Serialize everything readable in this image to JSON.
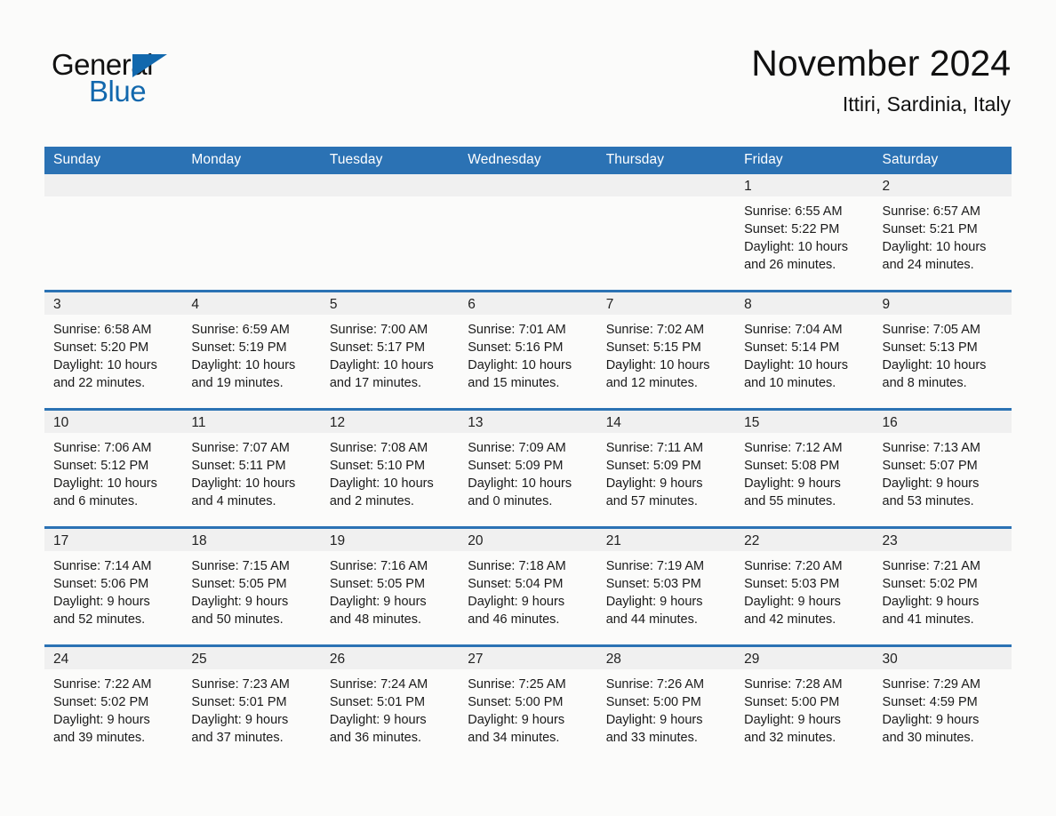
{
  "brand": {
    "name_part1": "General",
    "name_part2": "Blue",
    "accent_color": "#1268ad"
  },
  "header": {
    "title": "November 2024",
    "subtitle": "Ittiri, Sardinia, Italy"
  },
  "theme": {
    "header_blue": "#2b72b4",
    "daynum_band": "#f0f0f0",
    "page_background": "#fbfbfa"
  },
  "weekday_headers": [
    "Sunday",
    "Monday",
    "Tuesday",
    "Wednesday",
    "Thursday",
    "Friday",
    "Saturday"
  ],
  "weeks": [
    [
      {
        "day": "",
        "empty": true
      },
      {
        "day": "",
        "empty": true
      },
      {
        "day": "",
        "empty": true
      },
      {
        "day": "",
        "empty": true
      },
      {
        "day": "",
        "empty": true
      },
      {
        "day": "1",
        "sunrise": "Sunrise: 6:55 AM",
        "sunset": "Sunset: 5:22 PM",
        "daylight1": "Daylight: 10 hours",
        "daylight2": "and 26 minutes."
      },
      {
        "day": "2",
        "sunrise": "Sunrise: 6:57 AM",
        "sunset": "Sunset: 5:21 PM",
        "daylight1": "Daylight: 10 hours",
        "daylight2": "and 24 minutes."
      }
    ],
    [
      {
        "day": "3",
        "sunrise": "Sunrise: 6:58 AM",
        "sunset": "Sunset: 5:20 PM",
        "daylight1": "Daylight: 10 hours",
        "daylight2": "and 22 minutes."
      },
      {
        "day": "4",
        "sunrise": "Sunrise: 6:59 AM",
        "sunset": "Sunset: 5:19 PM",
        "daylight1": "Daylight: 10 hours",
        "daylight2": "and 19 minutes."
      },
      {
        "day": "5",
        "sunrise": "Sunrise: 7:00 AM",
        "sunset": "Sunset: 5:17 PM",
        "daylight1": "Daylight: 10 hours",
        "daylight2": "and 17 minutes."
      },
      {
        "day": "6",
        "sunrise": "Sunrise: 7:01 AM",
        "sunset": "Sunset: 5:16 PM",
        "daylight1": "Daylight: 10 hours",
        "daylight2": "and 15 minutes."
      },
      {
        "day": "7",
        "sunrise": "Sunrise: 7:02 AM",
        "sunset": "Sunset: 5:15 PM",
        "daylight1": "Daylight: 10 hours",
        "daylight2": "and 12 minutes."
      },
      {
        "day": "8",
        "sunrise": "Sunrise: 7:04 AM",
        "sunset": "Sunset: 5:14 PM",
        "daylight1": "Daylight: 10 hours",
        "daylight2": "and 10 minutes."
      },
      {
        "day": "9",
        "sunrise": "Sunrise: 7:05 AM",
        "sunset": "Sunset: 5:13 PM",
        "daylight1": "Daylight: 10 hours",
        "daylight2": "and 8 minutes."
      }
    ],
    [
      {
        "day": "10",
        "sunrise": "Sunrise: 7:06 AM",
        "sunset": "Sunset: 5:12 PM",
        "daylight1": "Daylight: 10 hours",
        "daylight2": "and 6 minutes."
      },
      {
        "day": "11",
        "sunrise": "Sunrise: 7:07 AM",
        "sunset": "Sunset: 5:11 PM",
        "daylight1": "Daylight: 10 hours",
        "daylight2": "and 4 minutes."
      },
      {
        "day": "12",
        "sunrise": "Sunrise: 7:08 AM",
        "sunset": "Sunset: 5:10 PM",
        "daylight1": "Daylight: 10 hours",
        "daylight2": "and 2 minutes."
      },
      {
        "day": "13",
        "sunrise": "Sunrise: 7:09 AM",
        "sunset": "Sunset: 5:09 PM",
        "daylight1": "Daylight: 10 hours",
        "daylight2": "and 0 minutes."
      },
      {
        "day": "14",
        "sunrise": "Sunrise: 7:11 AM",
        "sunset": "Sunset: 5:09 PM",
        "daylight1": "Daylight: 9 hours",
        "daylight2": "and 57 minutes."
      },
      {
        "day": "15",
        "sunrise": "Sunrise: 7:12 AM",
        "sunset": "Sunset: 5:08 PM",
        "daylight1": "Daylight: 9 hours",
        "daylight2": "and 55 minutes."
      },
      {
        "day": "16",
        "sunrise": "Sunrise: 7:13 AM",
        "sunset": "Sunset: 5:07 PM",
        "daylight1": "Daylight: 9 hours",
        "daylight2": "and 53 minutes."
      }
    ],
    [
      {
        "day": "17",
        "sunrise": "Sunrise: 7:14 AM",
        "sunset": "Sunset: 5:06 PM",
        "daylight1": "Daylight: 9 hours",
        "daylight2": "and 52 minutes."
      },
      {
        "day": "18",
        "sunrise": "Sunrise: 7:15 AM",
        "sunset": "Sunset: 5:05 PM",
        "daylight1": "Daylight: 9 hours",
        "daylight2": "and 50 minutes."
      },
      {
        "day": "19",
        "sunrise": "Sunrise: 7:16 AM",
        "sunset": "Sunset: 5:05 PM",
        "daylight1": "Daylight: 9 hours",
        "daylight2": "and 48 minutes."
      },
      {
        "day": "20",
        "sunrise": "Sunrise: 7:18 AM",
        "sunset": "Sunset: 5:04 PM",
        "daylight1": "Daylight: 9 hours",
        "daylight2": "and 46 minutes."
      },
      {
        "day": "21",
        "sunrise": "Sunrise: 7:19 AM",
        "sunset": "Sunset: 5:03 PM",
        "daylight1": "Daylight: 9 hours",
        "daylight2": "and 44 minutes."
      },
      {
        "day": "22",
        "sunrise": "Sunrise: 7:20 AM",
        "sunset": "Sunset: 5:03 PM",
        "daylight1": "Daylight: 9 hours",
        "daylight2": "and 42 minutes."
      },
      {
        "day": "23",
        "sunrise": "Sunrise: 7:21 AM",
        "sunset": "Sunset: 5:02 PM",
        "daylight1": "Daylight: 9 hours",
        "daylight2": "and 41 minutes."
      }
    ],
    [
      {
        "day": "24",
        "sunrise": "Sunrise: 7:22 AM",
        "sunset": "Sunset: 5:02 PM",
        "daylight1": "Daylight: 9 hours",
        "daylight2": "and 39 minutes."
      },
      {
        "day": "25",
        "sunrise": "Sunrise: 7:23 AM",
        "sunset": "Sunset: 5:01 PM",
        "daylight1": "Daylight: 9 hours",
        "daylight2": "and 37 minutes."
      },
      {
        "day": "26",
        "sunrise": "Sunrise: 7:24 AM",
        "sunset": "Sunset: 5:01 PM",
        "daylight1": "Daylight: 9 hours",
        "daylight2": "and 36 minutes."
      },
      {
        "day": "27",
        "sunrise": "Sunrise: 7:25 AM",
        "sunset": "Sunset: 5:00 PM",
        "daylight1": "Daylight: 9 hours",
        "daylight2": "and 34 minutes."
      },
      {
        "day": "28",
        "sunrise": "Sunrise: 7:26 AM",
        "sunset": "Sunset: 5:00 PM",
        "daylight1": "Daylight: 9 hours",
        "daylight2": "and 33 minutes."
      },
      {
        "day": "29",
        "sunrise": "Sunrise: 7:28 AM",
        "sunset": "Sunset: 5:00 PM",
        "daylight1": "Daylight: 9 hours",
        "daylight2": "and 32 minutes."
      },
      {
        "day": "30",
        "sunrise": "Sunrise: 7:29 AM",
        "sunset": "Sunset: 4:59 PM",
        "daylight1": "Daylight: 9 hours",
        "daylight2": "and 30 minutes."
      }
    ]
  ]
}
